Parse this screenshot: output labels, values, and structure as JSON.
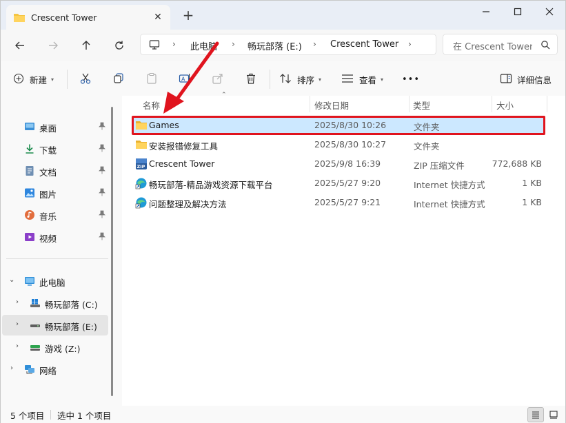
{
  "tab": {
    "title": "Crescent Tower"
  },
  "address": {
    "crumbs": [
      "此电脑",
      "畅玩部落 (E:)",
      "Crescent Tower"
    ]
  },
  "search": {
    "placeholder": "在 Crescent Tower"
  },
  "toolbar": {
    "new_label": "新建",
    "sort_label": "排序",
    "view_label": "查看",
    "more_label": "•••",
    "details_label": "详细信息"
  },
  "sidebar": {
    "pinned": [
      {
        "label": "桌面",
        "icon": "desktop-icon"
      },
      {
        "label": "下载",
        "icon": "download-icon"
      },
      {
        "label": "文档",
        "icon": "document-icon"
      },
      {
        "label": "图片",
        "icon": "pictures-icon"
      },
      {
        "label": "音乐",
        "icon": "music-icon"
      },
      {
        "label": "视频",
        "icon": "video-icon"
      }
    ],
    "this_pc": "此电脑",
    "drives": [
      {
        "label": "畅玩部落 (C:)"
      },
      {
        "label": "畅玩部落 (E:)"
      },
      {
        "label": "游戏 (Z:)"
      }
    ],
    "network": "网络"
  },
  "columns": {
    "name": "名称",
    "modified": "修改日期",
    "type": "类型",
    "size": "大小"
  },
  "files": [
    {
      "name": "Games",
      "modified": "2025/8/30 10:26",
      "type": "文件夹",
      "size": "",
      "icon": "folder-icon"
    },
    {
      "name": "安装报错修复工具",
      "modified": "2025/8/30 10:27",
      "type": "文件夹",
      "size": "",
      "icon": "folder-icon"
    },
    {
      "name": "Crescent Tower",
      "modified": "2025/9/8 16:39",
      "type": "ZIP 压缩文件",
      "size": "772,688 KB",
      "icon": "zip-icon"
    },
    {
      "name": "畅玩部落-精品游戏资源下载平台",
      "modified": "2025/5/27 9:20",
      "type": "Internet 快捷方式",
      "size": "1 KB",
      "icon": "internet-shortcut-icon"
    },
    {
      "name": "问题整理及解决方法",
      "modified": "2025/5/27 9:21",
      "type": "Internet 快捷方式",
      "size": "1 KB",
      "icon": "internet-shortcut-icon"
    }
  ],
  "status": {
    "count": "5 个项目",
    "selected": "选中 1 个项目"
  },
  "colors": {
    "selection": "#cce8ff",
    "highlight": "#e0141e",
    "folder": "#f5c542"
  }
}
